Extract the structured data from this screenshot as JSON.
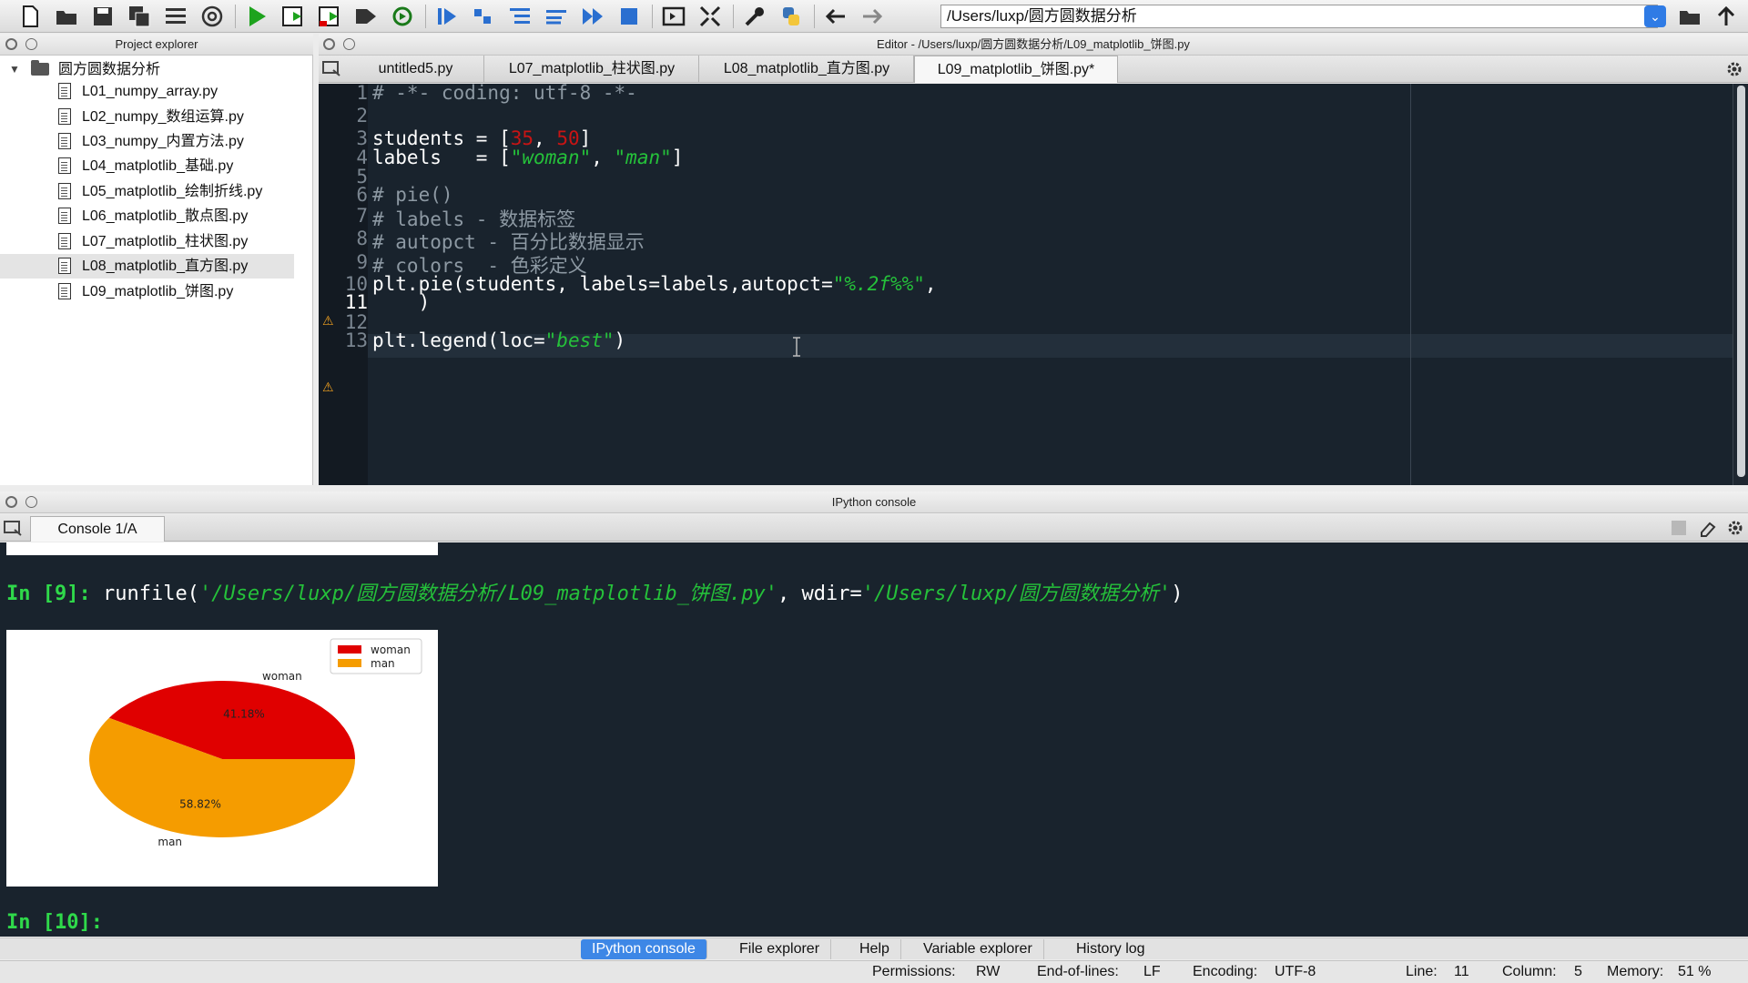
{
  "toolbar": {
    "icons": [
      "new-file-icon",
      "open-folder-icon",
      "save-icon",
      "save-all-icon",
      "list-icon",
      "at-sign-icon",
      "run-icon",
      "run-cell-icon",
      "run-cell-advance-icon",
      "run-selection-icon",
      "rerun-icon",
      "debug-icon",
      "step-icon",
      "step-into-icon",
      "step-return-icon",
      "continue-icon",
      "stop-icon",
      "maximize-pane-icon",
      "fullscreen-icon",
      "wrench-icon",
      "python-icon",
      "back-arrow-icon",
      "forward-arrow-icon"
    ],
    "path": "/Users/luxp/圆方圆数据分析"
  },
  "explorer": {
    "title": "Project explorer",
    "folder": "圆方圆数据分析",
    "files": [
      "L01_numpy_array.py",
      "L02_numpy_数组运算.py",
      "L03_numpy_内置方法.py",
      "L04_matplotlib_基础.py",
      "L05_matplotlib_绘制折线.py",
      "L06_matplotlib_散点图.py",
      "L07_matplotlib_柱状图.py",
      "L08_matplotlib_直方图.py",
      "L09_matplotlib_饼图.py"
    ],
    "selected_index": 7
  },
  "editor": {
    "title": "Editor - /Users/luxp/圆方圆数据分析/L09_matplotlib_饼图.py",
    "tabs": [
      "untitled5.py",
      "L07_matplotlib_柱状图.py",
      "L08_matplotlib_直方图.py",
      "L09_matplotlib_饼图.py*"
    ],
    "active_tab": 3,
    "line_numbers": [
      "1",
      "2",
      "3",
      "4",
      "5",
      "6",
      "7",
      "8",
      "9",
      "10",
      "11",
      "12",
      "13"
    ],
    "current_line": 11,
    "code": {
      "l1": "# -*- coding: utf-8 -*-",
      "l3_a": "students = [",
      "l3_n1": "35",
      "l3_b": ", ",
      "l3_n2": "50",
      "l3_c": "]",
      "l4_a": "labels   = [",
      "l4_s1": "\"woman\"",
      "l4_b": ", ",
      "l4_s2": "\"man\"",
      "l4_c": "]",
      "l6": "# pie()",
      "l7": "# labels - 数据标签",
      "l8": "# autopct - 百分比数据显示",
      "l9": "# colors  - 色彩定义",
      "l10_a": "plt.pie(students, labels=labels,autopct=",
      "l10_s": "\"%.2f%%\"",
      "l10_b": ",",
      "l11": "    )",
      "l13_a": "plt.legend(loc=",
      "l13_s": "\"best\"",
      "l13_b": ")"
    }
  },
  "console": {
    "title": "IPython console",
    "tab": "Console 1/A",
    "in9_prompt": "In [9]: ",
    "in9_cmd_a": "runfile(",
    "in9_str1": "'/Users/luxp/圆方圆数据分析/L09_matplotlib_饼图.py'",
    "in9_cmd_b": ", wdir=",
    "in9_str2": "'/Users/luxp/圆方圆数据分析'",
    "in9_cmd_c": ")",
    "in10_prompt": "In [10]: "
  },
  "chart_data": {
    "type": "pie",
    "categories": [
      "woman",
      "man"
    ],
    "values": [
      35,
      50
    ],
    "percent_labels": [
      "41.18%",
      "58.82%"
    ],
    "colors": [
      "#e00000",
      "#f59c00"
    ],
    "legend": [
      "woman",
      "man"
    ],
    "legend_placement": "top-right"
  },
  "bottom_tabs": [
    "IPython console",
    "File explorer",
    "Help",
    "Variable explorer",
    "History log"
  ],
  "status": {
    "permissions_label": "Permissions:",
    "permissions": "RW",
    "eol_label": "End-of-lines:",
    "eol": "LF",
    "encoding_label": "Encoding:",
    "encoding": "UTF-8",
    "line_label": "Line:",
    "line": "11",
    "column_label": "Column:",
    "column": "5",
    "memory_label": "Memory:",
    "memory": "51 %"
  }
}
